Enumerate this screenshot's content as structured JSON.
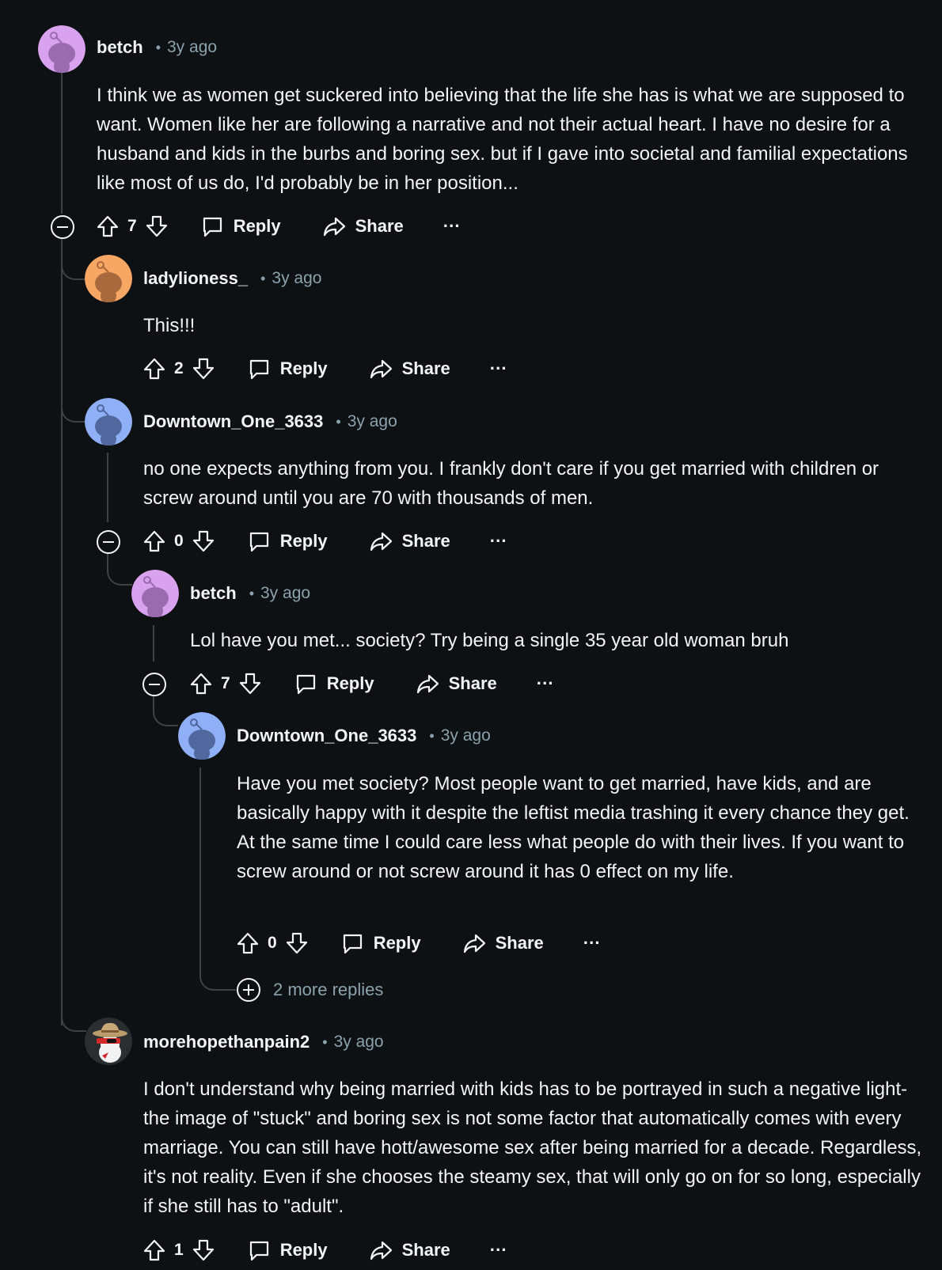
{
  "colors": {
    "background": "#0e1113",
    "text": "#f2f4f5",
    "meta": "#8ba2ad",
    "thread_line": "#3e4245",
    "avatar_pink": "#d9a2ee",
    "avatar_orange": "#f7a663",
    "avatar_blue": "#8fb0f7"
  },
  "comments": [
    {
      "author": "betch",
      "time": "3y ago",
      "avatar": "snoo-pink-avatar",
      "body": "I think we as women get suckered into believing that the life she has is what we are supposed to want. Women like her are following a narrative and not their actual heart. I have no desire for a husband and kids in the burbs and boring sex. but if I gave into societal and familial expectations like most of us do, I'd probably be in her position...",
      "votes": "7",
      "reply_label": "Reply",
      "share_label": "Share",
      "more_label": "···"
    },
    {
      "author": "ladylioness_",
      "time": "3y ago",
      "avatar": "snoo-orange-avatar",
      "body": "This!!!",
      "votes": "2",
      "reply_label": "Reply",
      "share_label": "Share",
      "more_label": "···"
    },
    {
      "author": "Downtown_One_3633",
      "time": "3y ago",
      "avatar": "snoo-blue-avatar",
      "body": "no one expects anything from you. I frankly don't care if you get married with children or screw around until you are 70 with thousands of men.",
      "votes": "0",
      "reply_label": "Reply",
      "share_label": "Share",
      "more_label": "···"
    },
    {
      "author": "betch",
      "time": "3y ago",
      "avatar": "snoo-pink-avatar",
      "body": "Lol have you met... society? Try being a single 35 year old woman bruh",
      "votes": "7",
      "reply_label": "Reply",
      "share_label": "Share",
      "more_label": "···"
    },
    {
      "author": "Downtown_One_3633",
      "time": "3y ago",
      "avatar": "snoo-blue-avatar",
      "body": "Have you met society? Most people want to get married, have kids, and are basically happy with it despite the leftist media trashing it every chance they get. At the same time I could care less what people do with their lives. If you want to screw around or not screw around it has 0 effect on my life.",
      "votes": "0",
      "reply_label": "Reply",
      "share_label": "Share",
      "more_label": "···"
    },
    {
      "author": "morehopethanpain2",
      "time": "3y ago",
      "avatar": "cowboy-hat-avatar",
      "body": "I don't understand why being married with kids has to be portrayed in such a negative light- the image of \"stuck\" and boring sex is not some factor that automatically comes with every marriage. You can still have hott/awesome sex after being married for a decade. Regardless, it's not reality. Even if she chooses the steamy sex, that will only go on for so long, especially if she still has to \"adult\".",
      "votes": "1",
      "reply_label": "Reply",
      "share_label": "Share",
      "more_label": "···"
    }
  ],
  "more_replies_label": "2 more replies"
}
